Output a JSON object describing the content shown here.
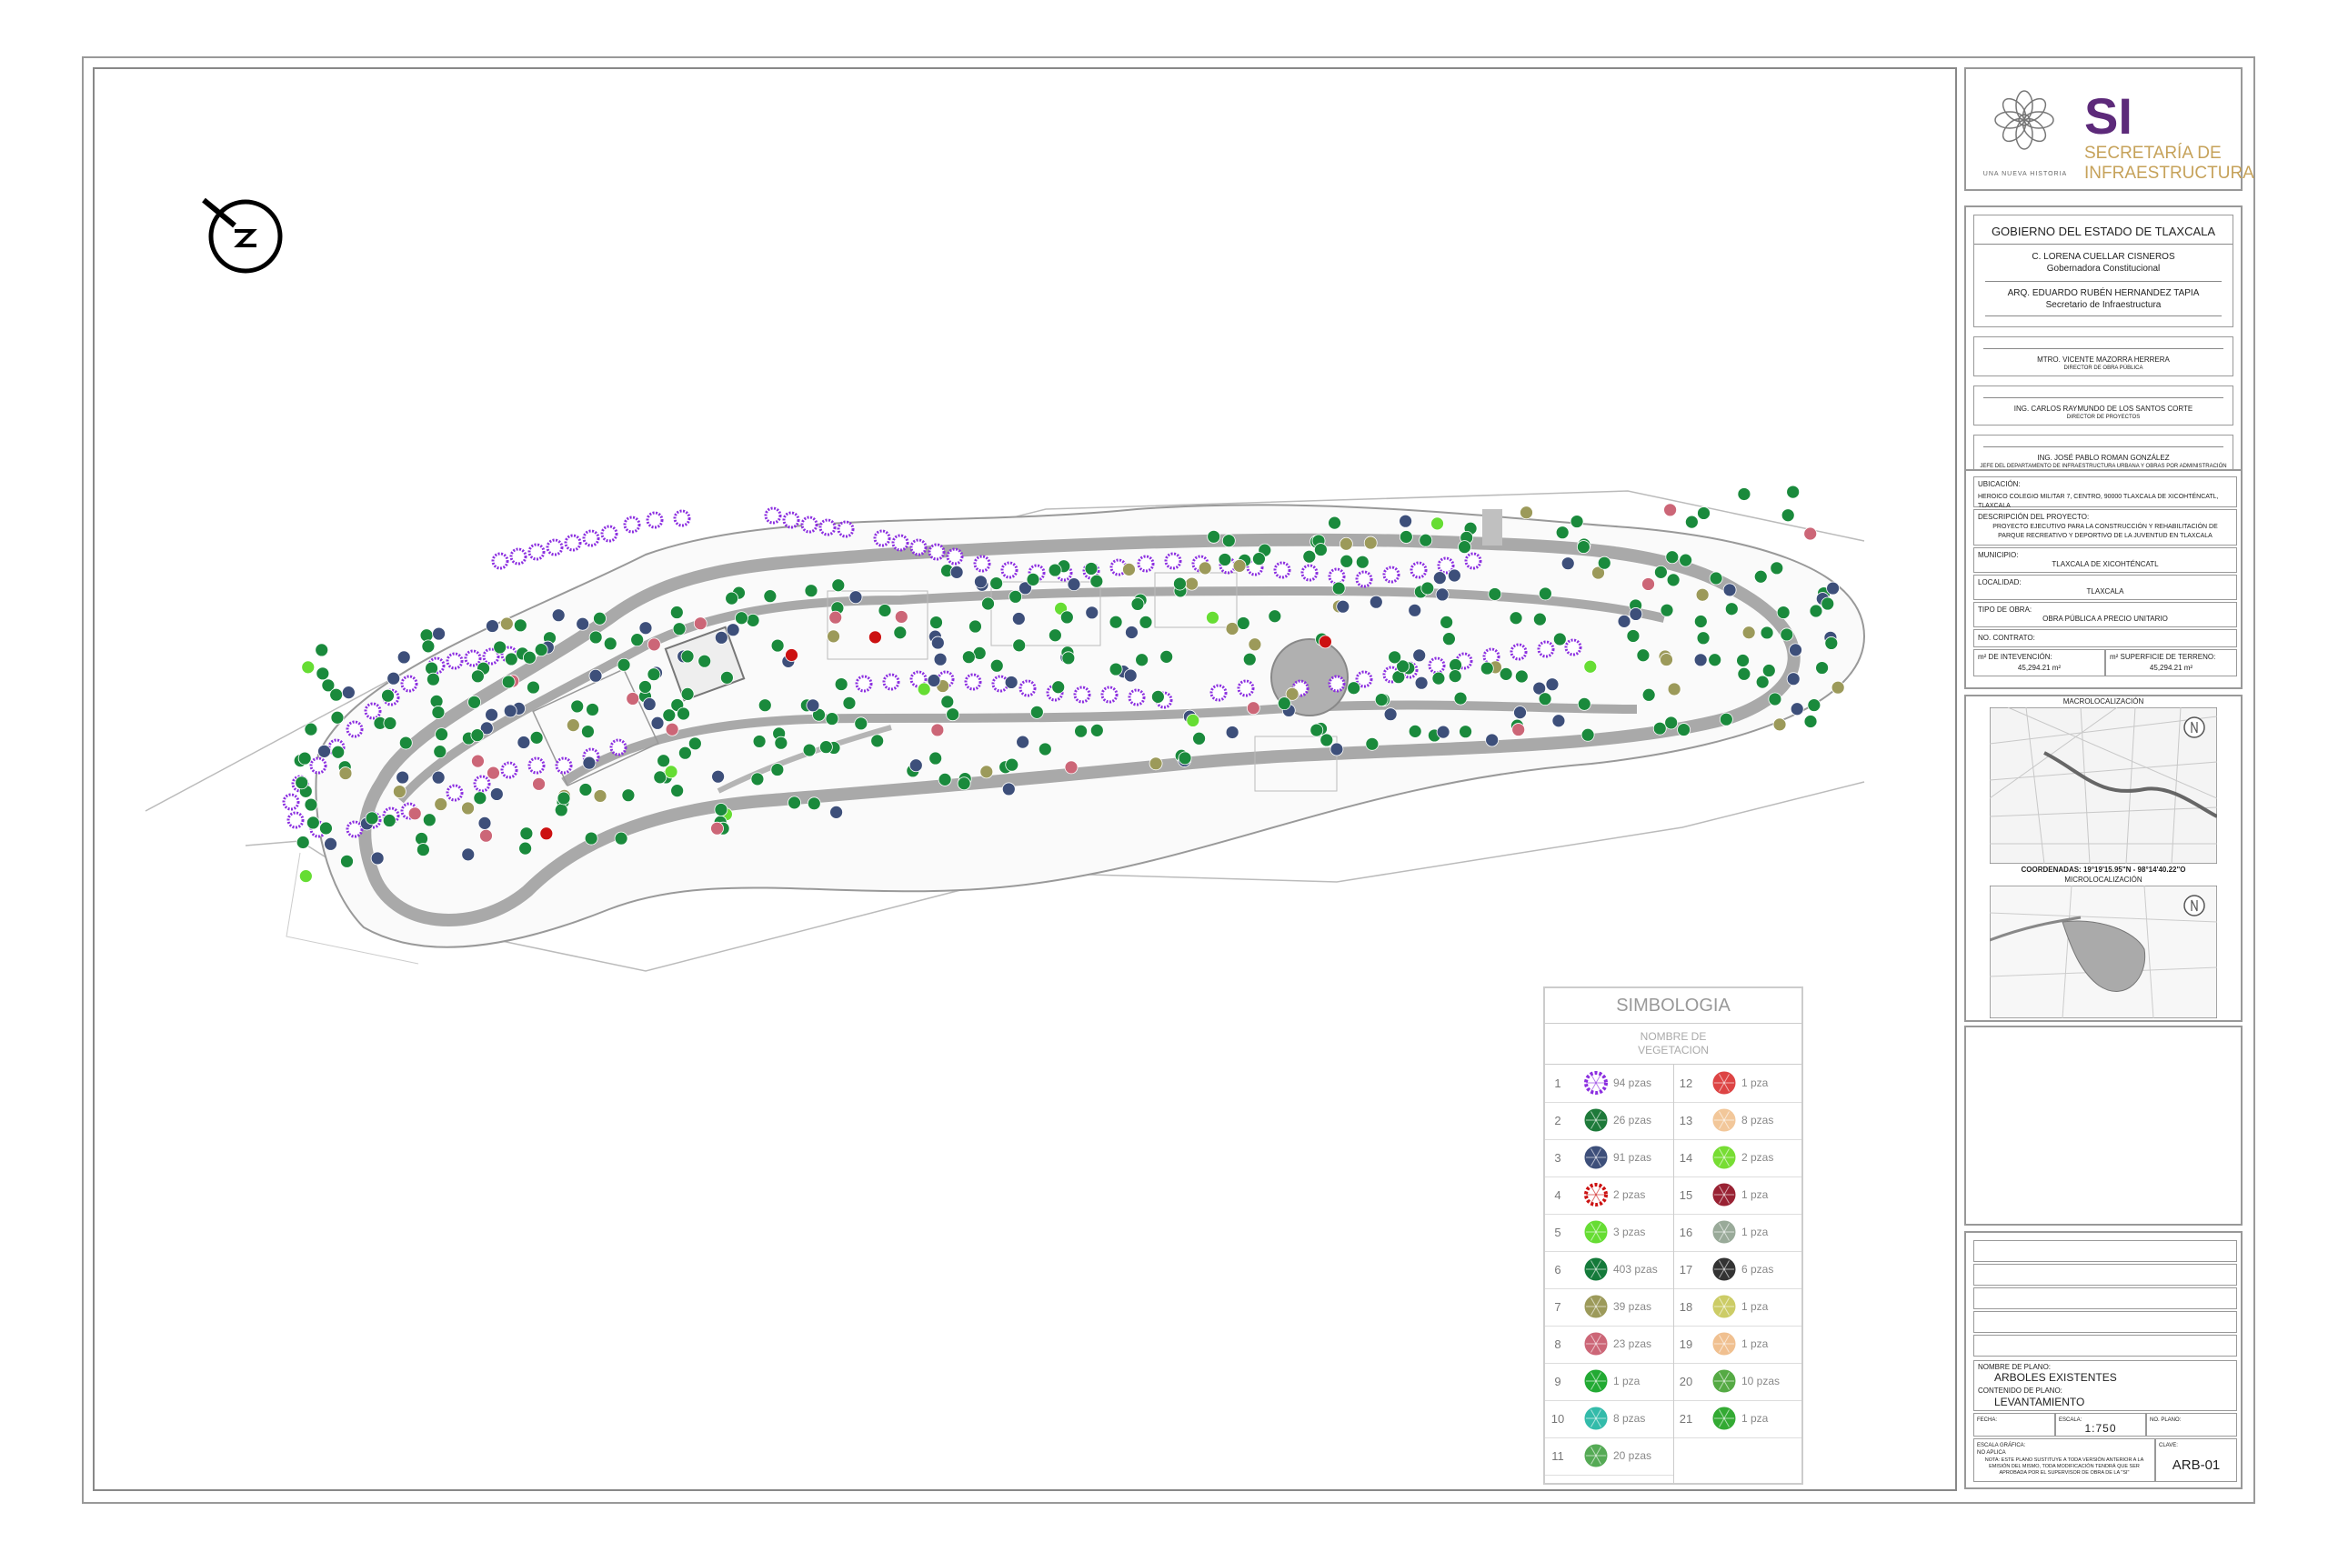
{
  "north_arrow": {
    "icon": "north-arrow-icon"
  },
  "site_plan": {
    "park_name": "parque recreativo",
    "colors": {
      "path": "#a9a9a9",
      "tree_dark": "#1a8a3c",
      "tree_purple": "#8b2ee0",
      "tree_navy": "#3d4f7a",
      "tree_olive": "#9c9a5a",
      "tree_pink": "#cc6677",
      "tree_red": "#cc1111",
      "tree_lime": "#66dd33",
      "plaza": "#b0b0b0"
    }
  },
  "header": {
    "logo_caption": "UNA NUEVA HISTORIA",
    "logo_si": "SI",
    "logo_sub1": "SECRETARÍA DE",
    "logo_sub2": "INFRAESTRUCTURA",
    "government": "GOBIERNO DEL ESTADO DE TLAXCALA",
    "governor_name": "C. LORENA CUELLAR CISNEROS",
    "governor_title": "Gobernadora Constitucional",
    "secretary_name": "ARQ. EDUARDO RUBÉN HERNANDEZ TAPIA",
    "secretary_title": "Secretario de Infraestructura"
  },
  "signatories": [
    {
      "name": "MTRO. VICENTE MAZORRA HERRERA",
      "role": "DIRECTOR DE OBRA PÚBLICA"
    },
    {
      "name": "ING. CARLOS RAYMUNDO DE LOS SANTOS CORTE",
      "role": "DIRECTOR DE PROYECTOS"
    },
    {
      "name": "ING. JOSÉ PABLO ROMAN GONZÁLEZ",
      "role": "JEFE DEL DEPARTAMENTO DE INFRAESTRUCTURA URBANA Y OBRAS POR ADMINISTRACIÓN"
    }
  ],
  "project": {
    "ubicacion_label": "UBICACIÓN:",
    "ubicacion": "HEROICO COLEGIO MILITAR 7, CENTRO, 90000 TLAXCALA DE XICOHTÉNCATL, TLAXCALA",
    "descripcion_label": "DESCRIPCIÓN DEL PROYECTO:",
    "descripcion": "PROYECTO EJECUTIVO PARA LA CONSTRUCCIÓN Y REHABILITACIÓN DE PARQUE RECREATIVO Y DEPORTIVO DE LA JUVENTUD EN TLAXCALA",
    "municipio_label": "MUNICIPIO:",
    "municipio": "TLAXCALA DE XICOHTÉNCATL",
    "localidad_label": "LOCALIDAD:",
    "localidad": "TLAXCALA",
    "tipo_label": "TIPO DE OBRA:",
    "tipo": "OBRA PÚBLICA A PRECIO UNITARIO",
    "contrato_label": "NO. CONTRATO:",
    "intervencion_label": "m² DE INTEVENCIÓN:",
    "intervencion": "45,294.21 m²",
    "superficie_label": "m² SUPERFICIE DE TERRENO:",
    "superficie": "45,294.21 m²"
  },
  "location": {
    "macro_label": "MACROLOCALIZACIÓN",
    "coords": "COORDENADAS: 19°19'15.95\"N - 98°14'40.22\"O",
    "micro_label": "MICROLOCALIZACIÓN"
  },
  "plano": {
    "nombre_label": "NOMBRE DE PLANO:",
    "nombre": "ARBOLES EXISTENTES",
    "contenido_label": "CONTENIDO DE PLANO:",
    "contenido": "LEVANTAMIENTO",
    "fecha_label": "FECHA:",
    "escala_label": "ESCALA:",
    "escala": "1:750",
    "no_plano_label": "NO. PLANO:",
    "escala_grafica_label": "ESCALA GRÁFICA:",
    "no_aplica": "NO APLICA",
    "clave_label": "CLAVE:",
    "clave": "ARB-01",
    "nota": "NOTA: ESTE PLANO SUSTITUYE A TODA VERSIÓN ANTERIOR A LA EMISIÓN DEL MISMO, TODA MODIFICACIÓN TENDRÁ QUE SER APROBADA POR EL SUPERVISOR DE OBRA DE LA \"SI\""
  },
  "legend": {
    "title": "SIMBOLOGIA",
    "subtitle1": "NOMBRE DE",
    "subtitle2": "VEGETACION",
    "items": [
      {
        "n": "1",
        "qty": "94 pzas",
        "color": "#8b2ee0",
        "icon": "ring-tree-icon"
      },
      {
        "n": "2",
        "qty": "26 pzas",
        "color": "#1e7a3a",
        "icon": "round-tree-icon"
      },
      {
        "n": "3",
        "qty": "91 pzas",
        "color": "#3d4f7a",
        "icon": "star-palm-icon"
      },
      {
        "n": "4",
        "qty": "2 pzas",
        "color": "#cc1111",
        "icon": "red-ring-icon"
      },
      {
        "n": "5",
        "qty": "3 pzas",
        "color": "#66dd33",
        "icon": "lime-shrub-icon"
      },
      {
        "n": "6",
        "qty": "403 pzas",
        "color": "#147a3a",
        "icon": "green-tree-icon"
      },
      {
        "n": "7",
        "qty": "39 pzas",
        "color": "#9c9a5a",
        "icon": "olive-tree-icon"
      },
      {
        "n": "8",
        "qty": "23 pzas",
        "color": "#cc6677",
        "icon": "pink-star-icon"
      },
      {
        "n": "9",
        "qty": "1 pza",
        "color": "#22aa33",
        "icon": "bright-tree-icon"
      },
      {
        "n": "10",
        "qty": "8 pzas",
        "color": "#33bbaa",
        "icon": "teal-tree-icon"
      },
      {
        "n": "11",
        "qty": "20 pzas",
        "color": "#55aa55",
        "icon": "fern-icon"
      },
      {
        "n": "12",
        "qty": "1 pza",
        "color": "#dd4444",
        "icon": "red-star-icon"
      },
      {
        "n": "13",
        "qty": "8 pzas",
        "color": "#f2c79a",
        "icon": "peach-shrub-icon"
      },
      {
        "n": "14",
        "qty": "2 pzas",
        "color": "#77dd33",
        "icon": "light-green-icon"
      },
      {
        "n": "15",
        "qty": "1 pza",
        "color": "#992233",
        "icon": "maroon-tree-icon"
      },
      {
        "n": "16",
        "qty": "1 pza",
        "color": "#99aa99",
        "icon": "grey-tree-icon"
      },
      {
        "n": "17",
        "qty": "6 pzas",
        "color": "#333333",
        "icon": "dark-tree-icon"
      },
      {
        "n": "18",
        "qty": "1 pza",
        "color": "#cccc66",
        "icon": "yellow-tree-icon"
      },
      {
        "n": "19",
        "qty": "1 pza",
        "color": "#f0c090",
        "icon": "tan-shrub-icon"
      },
      {
        "n": "20",
        "qty": "10 pzas",
        "color": "#55aa44",
        "icon": "grass-icon"
      },
      {
        "n": "21",
        "qty": "1 pza",
        "color": "#33aa33",
        "icon": "green-shrub-icon"
      }
    ]
  }
}
